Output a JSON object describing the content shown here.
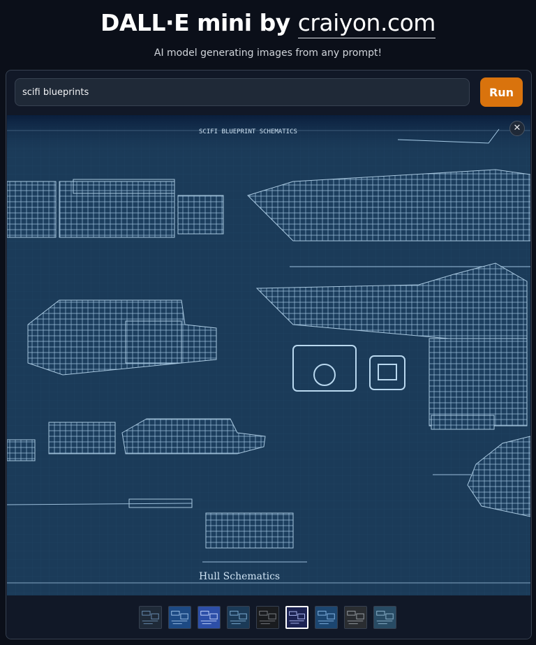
{
  "header": {
    "title_prefix": "DALL·E mini by ",
    "title_link": "craiyon.com",
    "subtitle": "AI model generating images from any prompt!"
  },
  "prompt": {
    "value": "scifi blueprints",
    "run_label": "Run"
  },
  "gallery": {
    "close_label": "✕",
    "image_overlay_text_top": "SCIFI BLUEPRINT SCHEMATICS",
    "image_overlay_text_bottom": "Hull Schematics"
  },
  "thumbnails": [
    {
      "bg": "#1f2a38",
      "fg": "#6b8fb3"
    },
    {
      "bg": "#1d4a84",
      "fg": "#9ec2ea"
    },
    {
      "bg": "#2d4fa8",
      "fg": "#c8d8ff"
    },
    {
      "bg": "#1b3a57",
      "fg": "#7fb0d6"
    },
    {
      "bg": "#1a1c1f",
      "fg": "#7c7f84"
    },
    {
      "bg": "#1c2352",
      "fg": "#b8c4ff"
    },
    {
      "bg": "#1c4670",
      "fg": "#86b7e6"
    },
    {
      "bg": "#2a2d31",
      "fg": "#9aa0a6"
    },
    {
      "bg": "#284b64",
      "fg": "#8fb6cf"
    }
  ],
  "selected_thumbnail_index": 5
}
